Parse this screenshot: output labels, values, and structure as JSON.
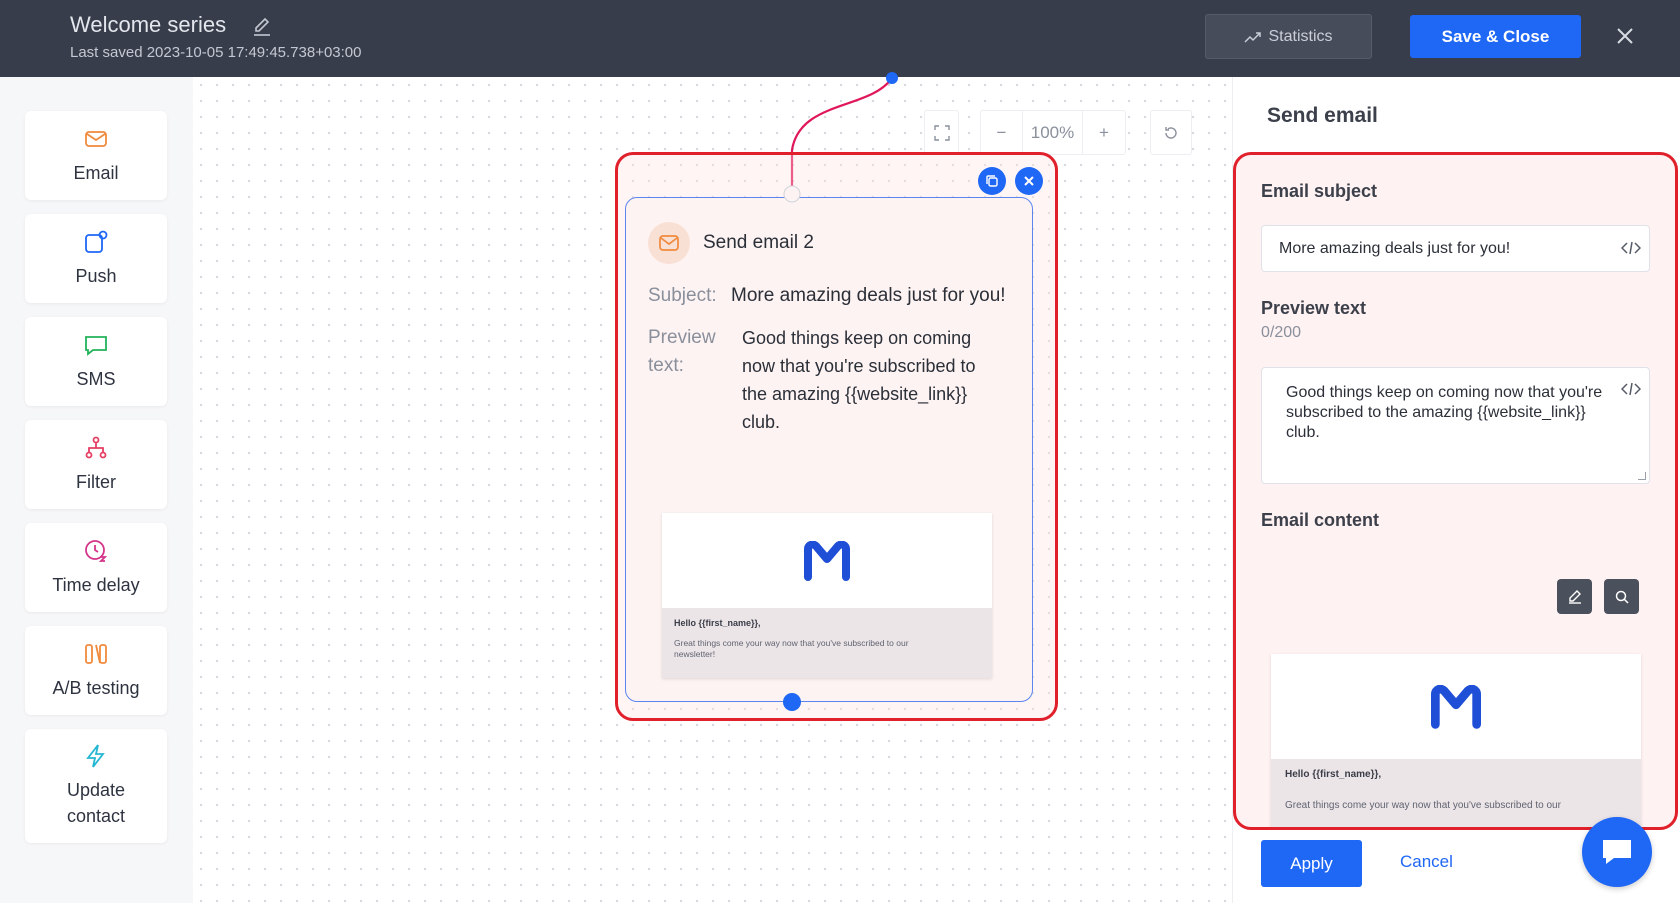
{
  "header": {
    "title": "Welcome series",
    "last_saved": "Last saved 2023-10-05 17:49:45.738+03:00",
    "statistics_label": "Statistics",
    "save_close_label": "Save & Close"
  },
  "palette": {
    "items": [
      {
        "label": "Email",
        "icon": "envelope-icon"
      },
      {
        "label": "Push",
        "icon": "push-notification-icon"
      },
      {
        "label": "SMS",
        "icon": "chat-bubble-icon"
      },
      {
        "label": "Filter",
        "icon": "filter-tree-icon"
      },
      {
        "label": "Time delay",
        "icon": "clock-icon"
      },
      {
        "label": "A/B testing",
        "icon": "ab-split-icon"
      },
      {
        "label": "Update contact",
        "icon": "lightning-icon"
      }
    ]
  },
  "canvas": {
    "zoom": "100%",
    "zoom_out": "−",
    "zoom_in": "+"
  },
  "node": {
    "title": "Send email 2",
    "subject_label": "Subject:",
    "subject_value": "More amazing deals just for you!",
    "preview_label": "Preview text:",
    "preview_value": "Good things keep on coming now that you're subscribed to the amazing {{website_link}} club.",
    "email_thumb": {
      "hello": "Hello {{first_name}},",
      "line": "Great things come your way now that you've subscribed to our newsletter!"
    }
  },
  "panel": {
    "title": "Send email",
    "subject_label": "Email subject",
    "subject_value": "More amazing deals just for you!",
    "preview_label": "Preview text",
    "preview_counter": "0/200",
    "preview_value": "Good things keep on coming now that you're subscribed to the amazing {{website_link}} club.",
    "content_label": "Email content",
    "email_thumb": {
      "hello": "Hello {{first_name}},",
      "line": "Great things come your way now that you've subscribed to our"
    },
    "apply_label": "Apply",
    "cancel_label": "Cancel"
  },
  "colors": {
    "accent": "#1f67f5",
    "topbar": "#373d4a",
    "highlight": "#e0202b"
  }
}
